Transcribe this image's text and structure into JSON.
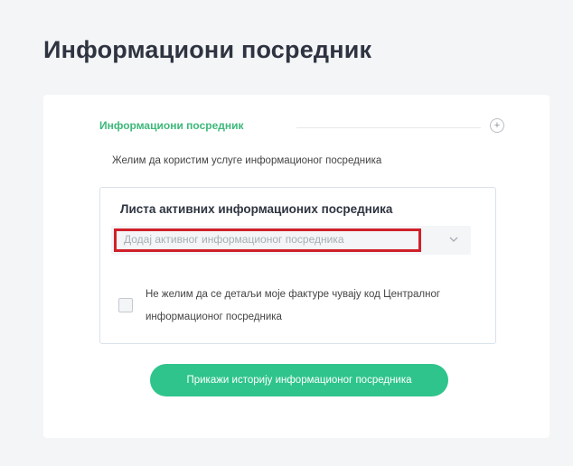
{
  "page": {
    "title": "Информациони посредник"
  },
  "section": {
    "title": "Информациони посредник",
    "collapse_icon": "plus-circle-icon",
    "use_service_label": "Желим да користим услуге информационог посредника"
  },
  "active_list": {
    "title": "Листа активних информационих посредника",
    "select_placeholder": "Додај активног информационог посредника",
    "select_icon": "chevron-down-icon",
    "consent_text": "Не желим да се детаљи моје фактуре чувају код Централног информационог посредника"
  },
  "actions": {
    "history_button_label": "Прикажи историју информационог посредника"
  },
  "colors": {
    "accent_green": "#2ec48c",
    "highlight_red": "#d0202a"
  }
}
